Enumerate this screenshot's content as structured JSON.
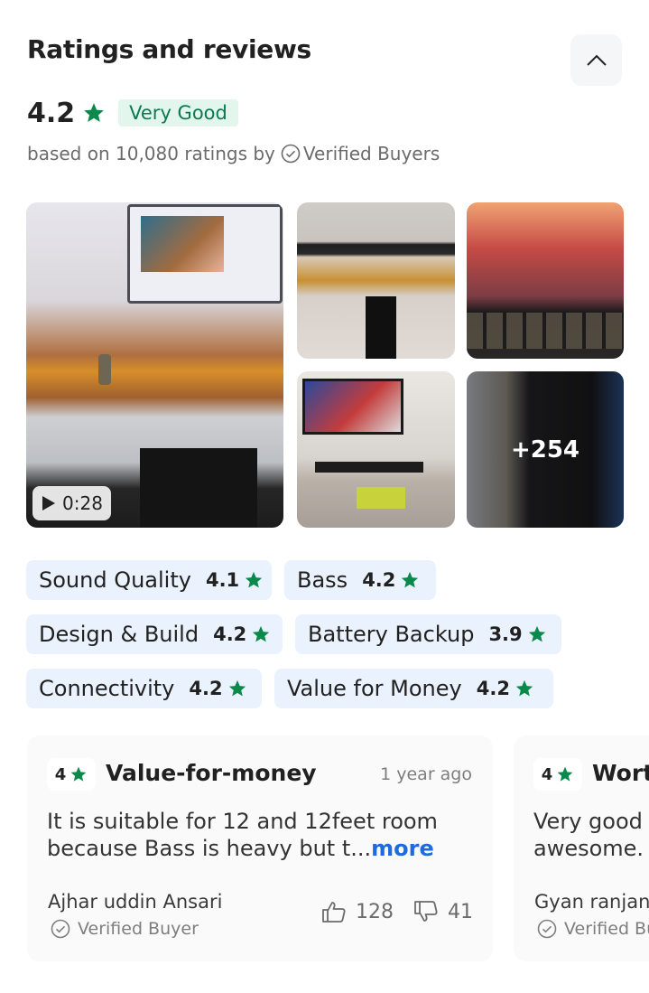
{
  "section": {
    "title": "Ratings and reviews",
    "collapse_icon": "chevron-up-icon"
  },
  "summary": {
    "rating": "4.2",
    "badge": "Very Good",
    "based_on_prefix": "based on 10,080 ratings by",
    "verified_label": "Verified Buyers"
  },
  "colors": {
    "star": "#0a8a4a",
    "badge_bg": "#e2f6ee",
    "badge_text": "#0c7a4e",
    "chip_bg": "#eaf2fd",
    "link": "#1d6cdf"
  },
  "media": {
    "video_duration": "0:28",
    "more_count": "+254"
  },
  "aspects": [
    {
      "label": "Sound Quality",
      "value": "4.1"
    },
    {
      "label": "Bass",
      "value": "4.2"
    },
    {
      "label": "Design & Build",
      "value": "4.2"
    },
    {
      "label": "Battery Backup",
      "value": "3.9"
    },
    {
      "label": "Connectivity",
      "value": "4.2"
    },
    {
      "label": "Value for Money",
      "value": "4.2"
    }
  ],
  "reviews": [
    {
      "rating": "4",
      "title": "Value-for-money",
      "date": "1 year ago",
      "body": "It is suitable for 12 and 12feet room because Bass is heavy but t...",
      "more": "more",
      "author": "Ajhar uddin Ansari",
      "verified": "Verified Buyer",
      "likes": "128",
      "dislikes": "41"
    },
    {
      "rating": "4",
      "title": "Wort",
      "body": "Very good awesome.",
      "author": "Gyan ranjan",
      "verified": "Verified Bu"
    }
  ]
}
